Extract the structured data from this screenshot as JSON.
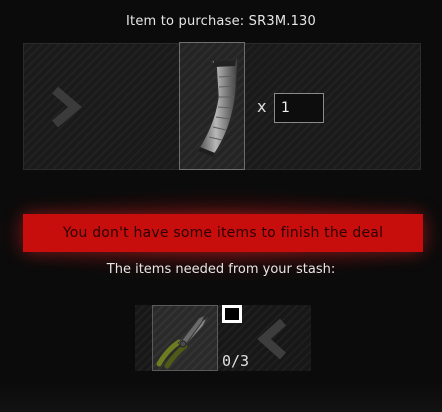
{
  "header": {
    "title": "Item to purchase: SR3M.130"
  },
  "offer": {
    "item_icon": "magazine-icon",
    "multiplier": "x",
    "quantity": "1"
  },
  "error": {
    "message": "You don't have some items to finish the deal"
  },
  "requirements": {
    "label": "The items needed from your stash:",
    "item_icon": "pliers-icon",
    "count": "0/3"
  },
  "colors": {
    "error_banner": "#c80d0d",
    "background": "#0b0b0b",
    "panel": "#1a1a1a"
  }
}
